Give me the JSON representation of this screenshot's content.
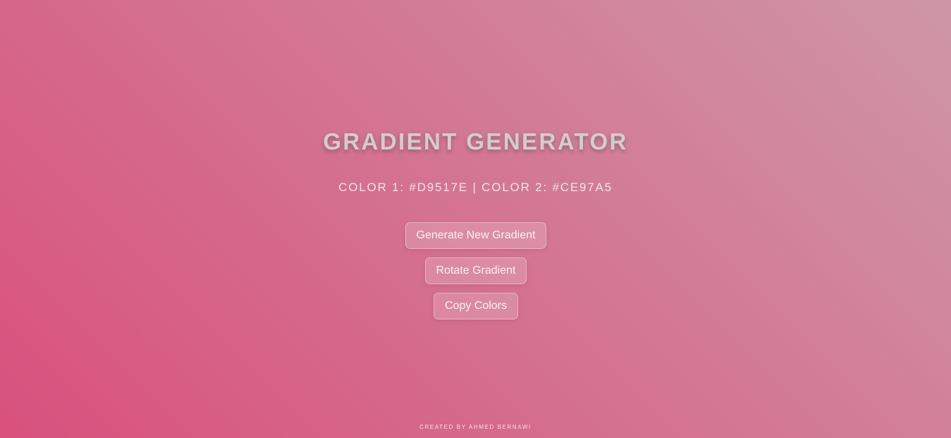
{
  "theme": {
    "color1": "#D9517E",
    "color2": "#CE97A5"
  },
  "header": {
    "title": "GRADIENT GENERATOR"
  },
  "colors_display": {
    "text": "COLOR 1: #D9517E | COLOR 2: #CE97A5"
  },
  "actions": {
    "generate_label": "Generate New Gradient",
    "rotate_label": "Rotate Gradient",
    "copy_label": "Copy Colors"
  },
  "footer": {
    "credit": "CREATED BY AHMED BERNAWI"
  }
}
